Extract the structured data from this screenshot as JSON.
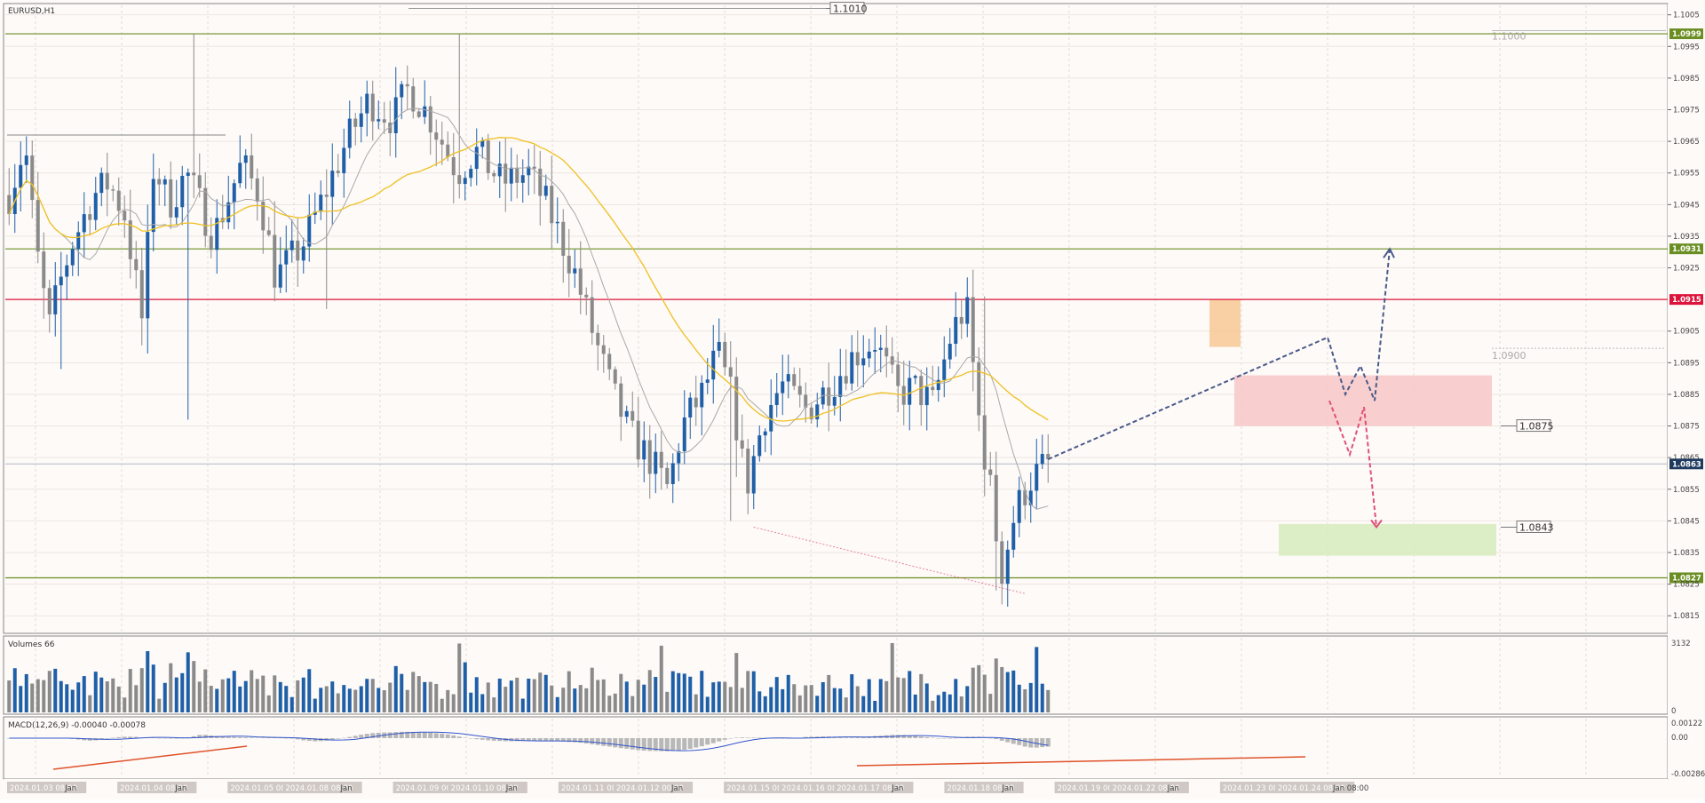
{
  "chart": {
    "title": "EURUSD,H1",
    "volumes_label": "Volumes 66",
    "macd_label": "MACD(12,26,9) -0.00040 -0.00078"
  },
  "price_axis": {
    "min": 1.081,
    "max": 1.1008,
    "ticks": [
      "1.1005",
      "1.0995",
      "1.0985",
      "1.0975",
      "1.0965",
      "1.0955",
      "1.0945",
      "1.0935",
      "1.0925",
      "1.0905",
      "1.0895",
      "1.0885",
      "1.0875",
      "1.0865",
      "1.0855",
      "1.0845",
      "1.0835",
      "1.0825",
      "1.0815"
    ]
  },
  "volume_axis": {
    "max_label": "3132",
    "zero_label": "0"
  },
  "macd_axis": {
    "top_label": "0.00122",
    "zero_label": "0.00",
    "bottom_label": "-0.00286"
  },
  "horizontal_levels": [
    {
      "price": 1.0999,
      "label": "1.0999",
      "color": "#6b8e23"
    },
    {
      "price": 1.0931,
      "label": "1.0931",
      "color": "#6b8e23"
    },
    {
      "price": 1.0915,
      "label": "1.0915",
      "color": "#dc143c"
    },
    {
      "price": 1.0827,
      "label": "1.0827",
      "color": "#6b8e23"
    }
  ],
  "current_price": {
    "price": 1.0863,
    "label": "1.0863",
    "color": "#1e3a5f"
  },
  "annotations": [
    {
      "text": "1.1000",
      "price": 1.1,
      "style": "gray"
    },
    {
      "text": "1.0900",
      "price": 1.0899,
      "style": "gray"
    },
    {
      "text": "1.0875",
      "price": 1.0875,
      "style": "boxed"
    },
    {
      "text": "1.0843",
      "price": 1.0843,
      "style": "boxed"
    },
    {
      "text": "1.1010",
      "price": 1.1007,
      "style": "boxed"
    }
  ],
  "date_labels": [
    "2024.01.03 08:00",
    "Jan",
    "2024.01.04 08:00",
    "Jan",
    "2024.01.05 08:00",
    "2024.01.08 08:00",
    "Jan",
    "2024.01.09 00:00",
    "2024.01.10 08:00",
    "Jan",
    "2024.01.11 08:00",
    "2024.01.12 00:00",
    "Jan",
    "2024.01.15 08:00",
    "2024.01.16 08:00",
    "2024.01.17 08:00",
    "Jan",
    "2024.01.18 08:00",
    "Jan",
    "2024.01.19 00:00",
    "2024.01.22 08:00",
    "Jan",
    "2024.01.23 08:00",
    "2024.01.24 08:00",
    "Jan 08:00"
  ],
  "colors": {
    "bull": "#1f5fa8",
    "bear": "#8a8a8a",
    "ma_fast": "#a9a9a9",
    "ma_slow": "#f0c020",
    "macd_line": "#3355cc",
    "divergence": "#e0522a",
    "resistance_zone": "#f7c7c7",
    "support_zone": "#d8ecc0",
    "swing_zone": "#f7c58d",
    "arrow_up": "#4a5a8a",
    "arrow_down": "#e0507a"
  },
  "chart_data": {
    "type": "candlestick",
    "symbol": "EURUSD",
    "timeframe": "H1",
    "ylim": [
      1.081,
      1.1008
    ],
    "overlays": [
      "moving-average-fast",
      "moving-average-slow",
      "volumes",
      "MACD(12,26,9)"
    ],
    "waypoints": [
      [
        0,
        1.0948
      ],
      [
        18,
        1.0964
      ],
      [
        30,
        1.0932
      ],
      [
        45,
        1.0906
      ],
      [
        55,
        1.0918
      ],
      [
        70,
        1.0932
      ],
      [
        95,
        1.0948
      ],
      [
        112,
        1.0952
      ],
      [
        130,
        1.0942
      ],
      [
        150,
        1.0908
      ],
      [
        163,
        1.0958
      ],
      [
        180,
        1.0945
      ],
      [
        200,
        1.0955
      ],
      [
        230,
        1.0935
      ],
      [
        262,
        1.0958
      ],
      [
        282,
        1.0948
      ],
      [
        300,
        1.0922
      ],
      [
        330,
        1.0932
      ],
      [
        355,
        1.0948
      ],
      [
        380,
        1.0965
      ],
      [
        405,
        1.0978
      ],
      [
        432,
        1.0972
      ],
      [
        450,
        1.0982
      ],
      [
        475,
        1.0972
      ],
      [
        505,
        1.0955
      ],
      [
        525,
        1.0962
      ],
      [
        555,
        1.0952
      ],
      [
        585,
        1.0955
      ],
      [
        605,
        1.0945
      ],
      [
        635,
        1.0925
      ],
      [
        660,
        1.0902
      ],
      [
        680,
        1.0885
      ],
      [
        700,
        1.0872
      ],
      [
        720,
        1.0865
      ],
      [
        742,
        1.0855
      ],
      [
        758,
        1.0875
      ],
      [
        780,
        1.0885
      ],
      [
        798,
        1.0898
      ],
      [
        815,
        1.0883
      ],
      [
        830,
        1.0855
      ],
      [
        850,
        1.0878
      ],
      [
        870,
        1.0888
      ],
      [
        898,
        1.088
      ],
      [
        925,
        1.0888
      ],
      [
        950,
        1.0897
      ],
      [
        975,
        1.0902
      ],
      [
        1000,
        1.0885
      ],
      [
        1020,
        1.0887
      ],
      [
        1040,
        1.0882
      ],
      [
        1062,
        1.0905
      ],
      [
        1078,
        1.0913
      ],
      [
        1093,
        1.0875
      ],
      [
        1105,
        1.0855
      ],
      [
        1117,
        1.0828
      ],
      [
        1133,
        1.0848
      ],
      [
        1150,
        1.0858
      ],
      [
        1168,
        1.0863
      ]
    ]
  }
}
